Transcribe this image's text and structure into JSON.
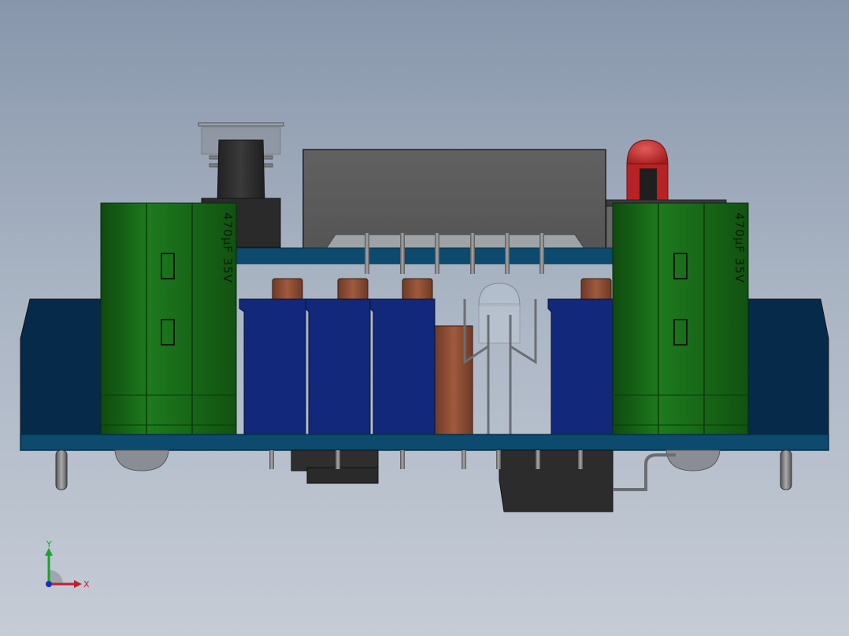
{
  "viewport": {
    "background_top": "#8796ab",
    "background_bottom": "#c6ccd6"
  },
  "colors": {
    "pcb": "#0c4a6e",
    "pcb_dark": "#062f47",
    "heatsink_side": "#062a4a",
    "capacitor": "#1c6e1c",
    "capacitor_dark": "#0f4a0f",
    "ceramic_cap": "#12287a",
    "resistor": "#8a4a30",
    "ic_body": "#5c5c5c",
    "led": "#c4282a",
    "pin": "#7a7e82"
  },
  "capacitors": {
    "left_label": "470μF 35V",
    "right_label": "470μF 35V"
  },
  "triad": {
    "y_label": "Y",
    "x_label": "X",
    "y_color": "#1aa32a",
    "x_color": "#c0202a",
    "z_color": "#1a2ec0"
  }
}
